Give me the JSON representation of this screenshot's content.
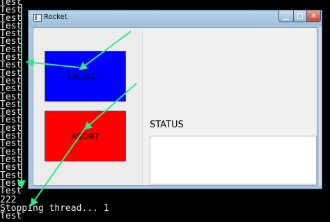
{
  "console": {
    "left_lines": [
      "Test",
      "Test",
      "Test",
      "Test",
      "Test",
      "Test",
      "Test",
      "Test",
      "Test",
      "Test",
      "Test",
      "Test",
      "Test",
      "Test",
      "Test",
      "Test",
      "Test",
      "Test",
      "Test",
      "Test",
      "Test",
      "Test",
      "Test",
      "Test",
      "Test"
    ],
    "bottom_lines": [
      "222",
      "Stopping thread... 1",
      "Test"
    ]
  },
  "window": {
    "title": "Rocket",
    "minimize_glyph": "▁",
    "maximize_glyph": "□",
    "close_glyph": "✕"
  },
  "buttons": {
    "launch_label": "LAUNCH",
    "abort_label": "ABORT"
  },
  "status": {
    "label": "STATUS",
    "value": ""
  },
  "colors": {
    "launch_bg": "#0000ff",
    "abort_bg": "#ff0000",
    "annotation_arrow": "#2ee88a"
  }
}
